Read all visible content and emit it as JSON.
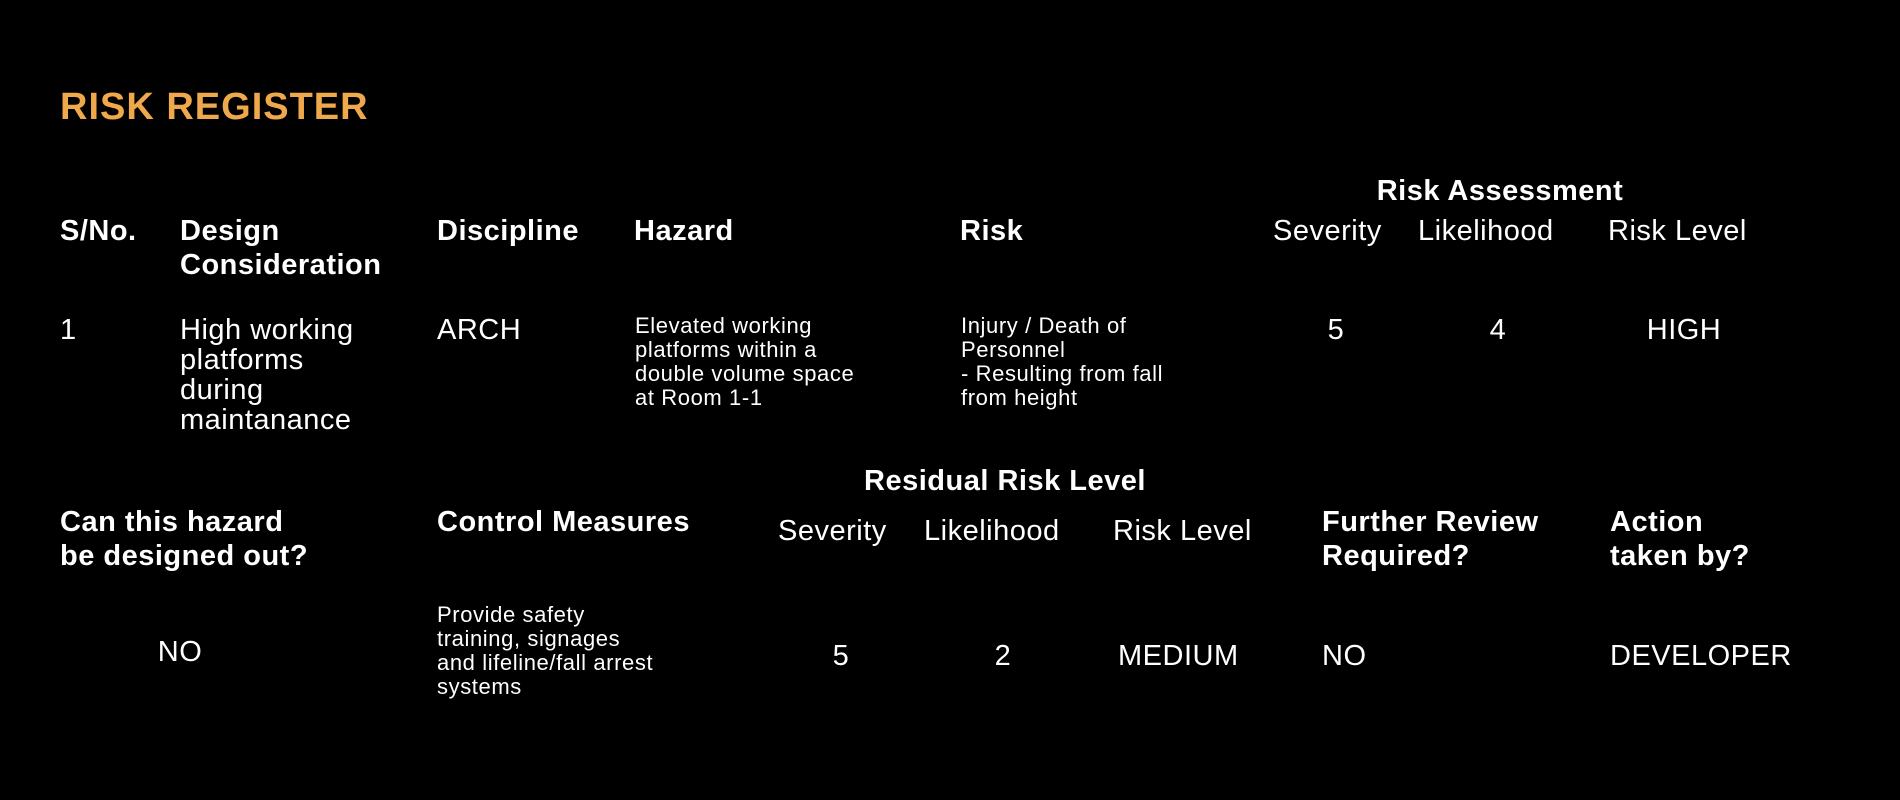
{
  "title": "RISK REGISTER",
  "section1": {
    "headers": {
      "sno": "S/No.",
      "design_consideration": "Design\nConsideration",
      "discipline": "Discipline",
      "hazard": "Hazard",
      "risk": "Risk",
      "risk_assessment_group": "Risk Assessment",
      "severity": "Severity",
      "likelihood": "Likelihood",
      "risk_level": "Risk Level"
    },
    "rows": [
      {
        "sno": "1",
        "design_consideration": "High working\nplatforms\nduring\nmaintanance",
        "discipline": "ARCH",
        "hazard": "Elevated working\nplatforms within a\ndouble volume space\nat Room 1-1",
        "risk": "Injury / Death of\nPersonnel\n- Resulting from fall\nfrom height",
        "severity": "5",
        "likelihood": "4",
        "risk_level": "HIGH"
      }
    ]
  },
  "section2": {
    "headers": {
      "designed_out": "Can this hazard\nbe designed out?",
      "control_measures": "Control Measures",
      "residual_group": "Residual Risk Level",
      "severity": "Severity",
      "likelihood": "Likelihood",
      "risk_level": "Risk Level",
      "further_review": "Further Review\nRequired?",
      "action_by": "Action\ntaken by?"
    },
    "rows": [
      {
        "designed_out": "NO",
        "control_measures": "Provide safety\ntraining, signages\nand lifeline/fall arrest\nsystems",
        "severity": "5",
        "likelihood": "2",
        "risk_level": "MEDIUM",
        "further_review": "NO",
        "action_by": "DEVELOPER"
      }
    ]
  },
  "colors": {
    "background": "#000000",
    "title": "#F0A84C",
    "text": "#FFFFFF"
  }
}
